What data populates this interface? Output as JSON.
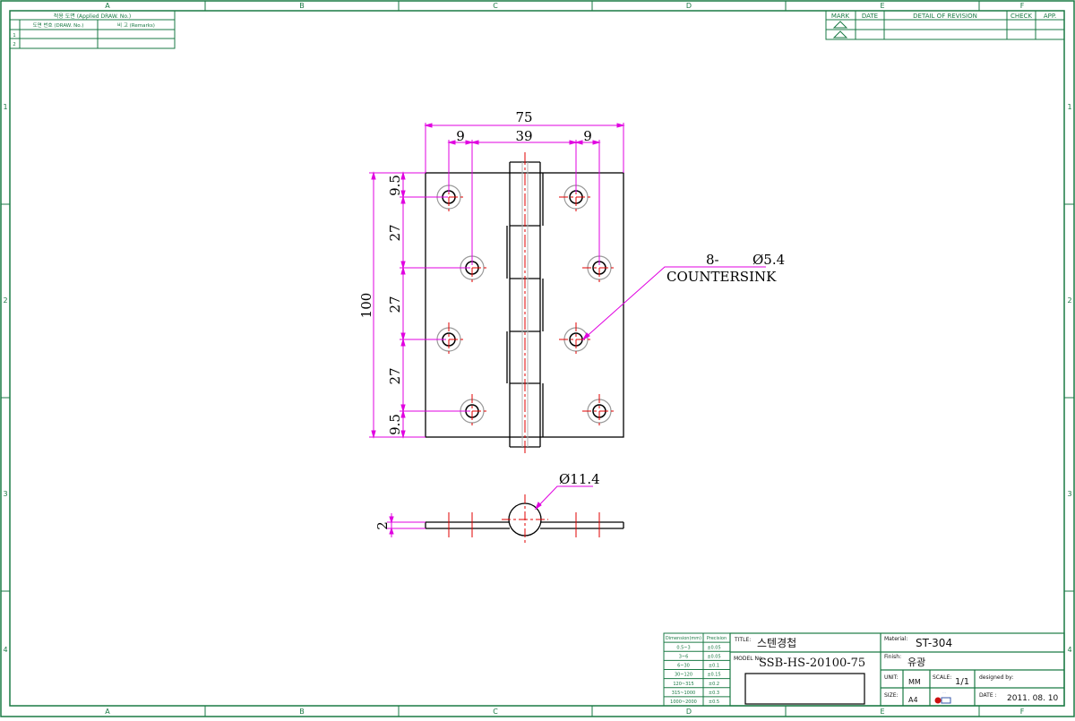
{
  "frame": {
    "zone_letters": [
      "A",
      "B",
      "C",
      "D",
      "E",
      "F"
    ],
    "zone_numbers": [
      "1",
      "2",
      "3",
      "4"
    ],
    "color": "#1a7a44"
  },
  "applied_drawings": {
    "title": "적용 도면 (Applied DRAW. No.)",
    "col_drawing_no": "도면 번호 (DRAW. No.)",
    "col_remarks": "비 고 (Remarks)",
    "row_numbers": [
      "1",
      "2"
    ]
  },
  "revision_table": {
    "headers": [
      "MARK",
      "DATE",
      "DETAIL OF REVISION",
      "CHECK",
      "APP."
    ]
  },
  "dimensions": {
    "overall_width": "75",
    "hole_offset_left": "9",
    "hole_spacing": "39",
    "hole_offset_right": "9",
    "overall_height": "100",
    "v_top": "9.5",
    "v_pitch_1": "27",
    "v_pitch_2": "27",
    "v_pitch_3": "27",
    "v_bottom": "9.5",
    "thickness": "2",
    "knuckle_dia": "Ø11.4",
    "hole_note_count": "8-",
    "hole_note_dia": "Ø5.4",
    "hole_note_type": "COUNTERSINK",
    "colors": {
      "dimension": "#e000e0",
      "centerline": "#e00000",
      "outline": "#000000"
    }
  },
  "tolerance_table": {
    "header_dim": "Dimension(mm)",
    "header_prec": "Precision",
    "rows": [
      {
        "dim": "0.5~3",
        "prec": "±0.05"
      },
      {
        "dim": "3~6",
        "prec": "±0.05"
      },
      {
        "dim": "6~30",
        "prec": "±0.1"
      },
      {
        "dim": "30~120",
        "prec": "±0.15"
      },
      {
        "dim": "120~315",
        "prec": "±0.2"
      },
      {
        "dim": "315~1000",
        "prec": "±0.3"
      },
      {
        "dim": "1000~2000",
        "prec": "±0.5"
      }
    ]
  },
  "title_block": {
    "title_label": "TITLE:",
    "title_value": "스텐경첩",
    "model_label": "MODEL No.",
    "model_value": "SSB-HS-20100-75",
    "material_label": "Material:",
    "material_value": "ST-304",
    "finish_label": "Finish:",
    "finish_value": "유광",
    "unit_label": "UNIT:",
    "unit_value": "MM",
    "scale_label": "SCALE:",
    "scale_value": "1/1",
    "designed_label": "designed by:",
    "size_label": "SIZE:",
    "size_value": "A4",
    "logo_text": "…",
    "date_label": "DATE :",
    "date_value": "2011. 08. 10"
  }
}
